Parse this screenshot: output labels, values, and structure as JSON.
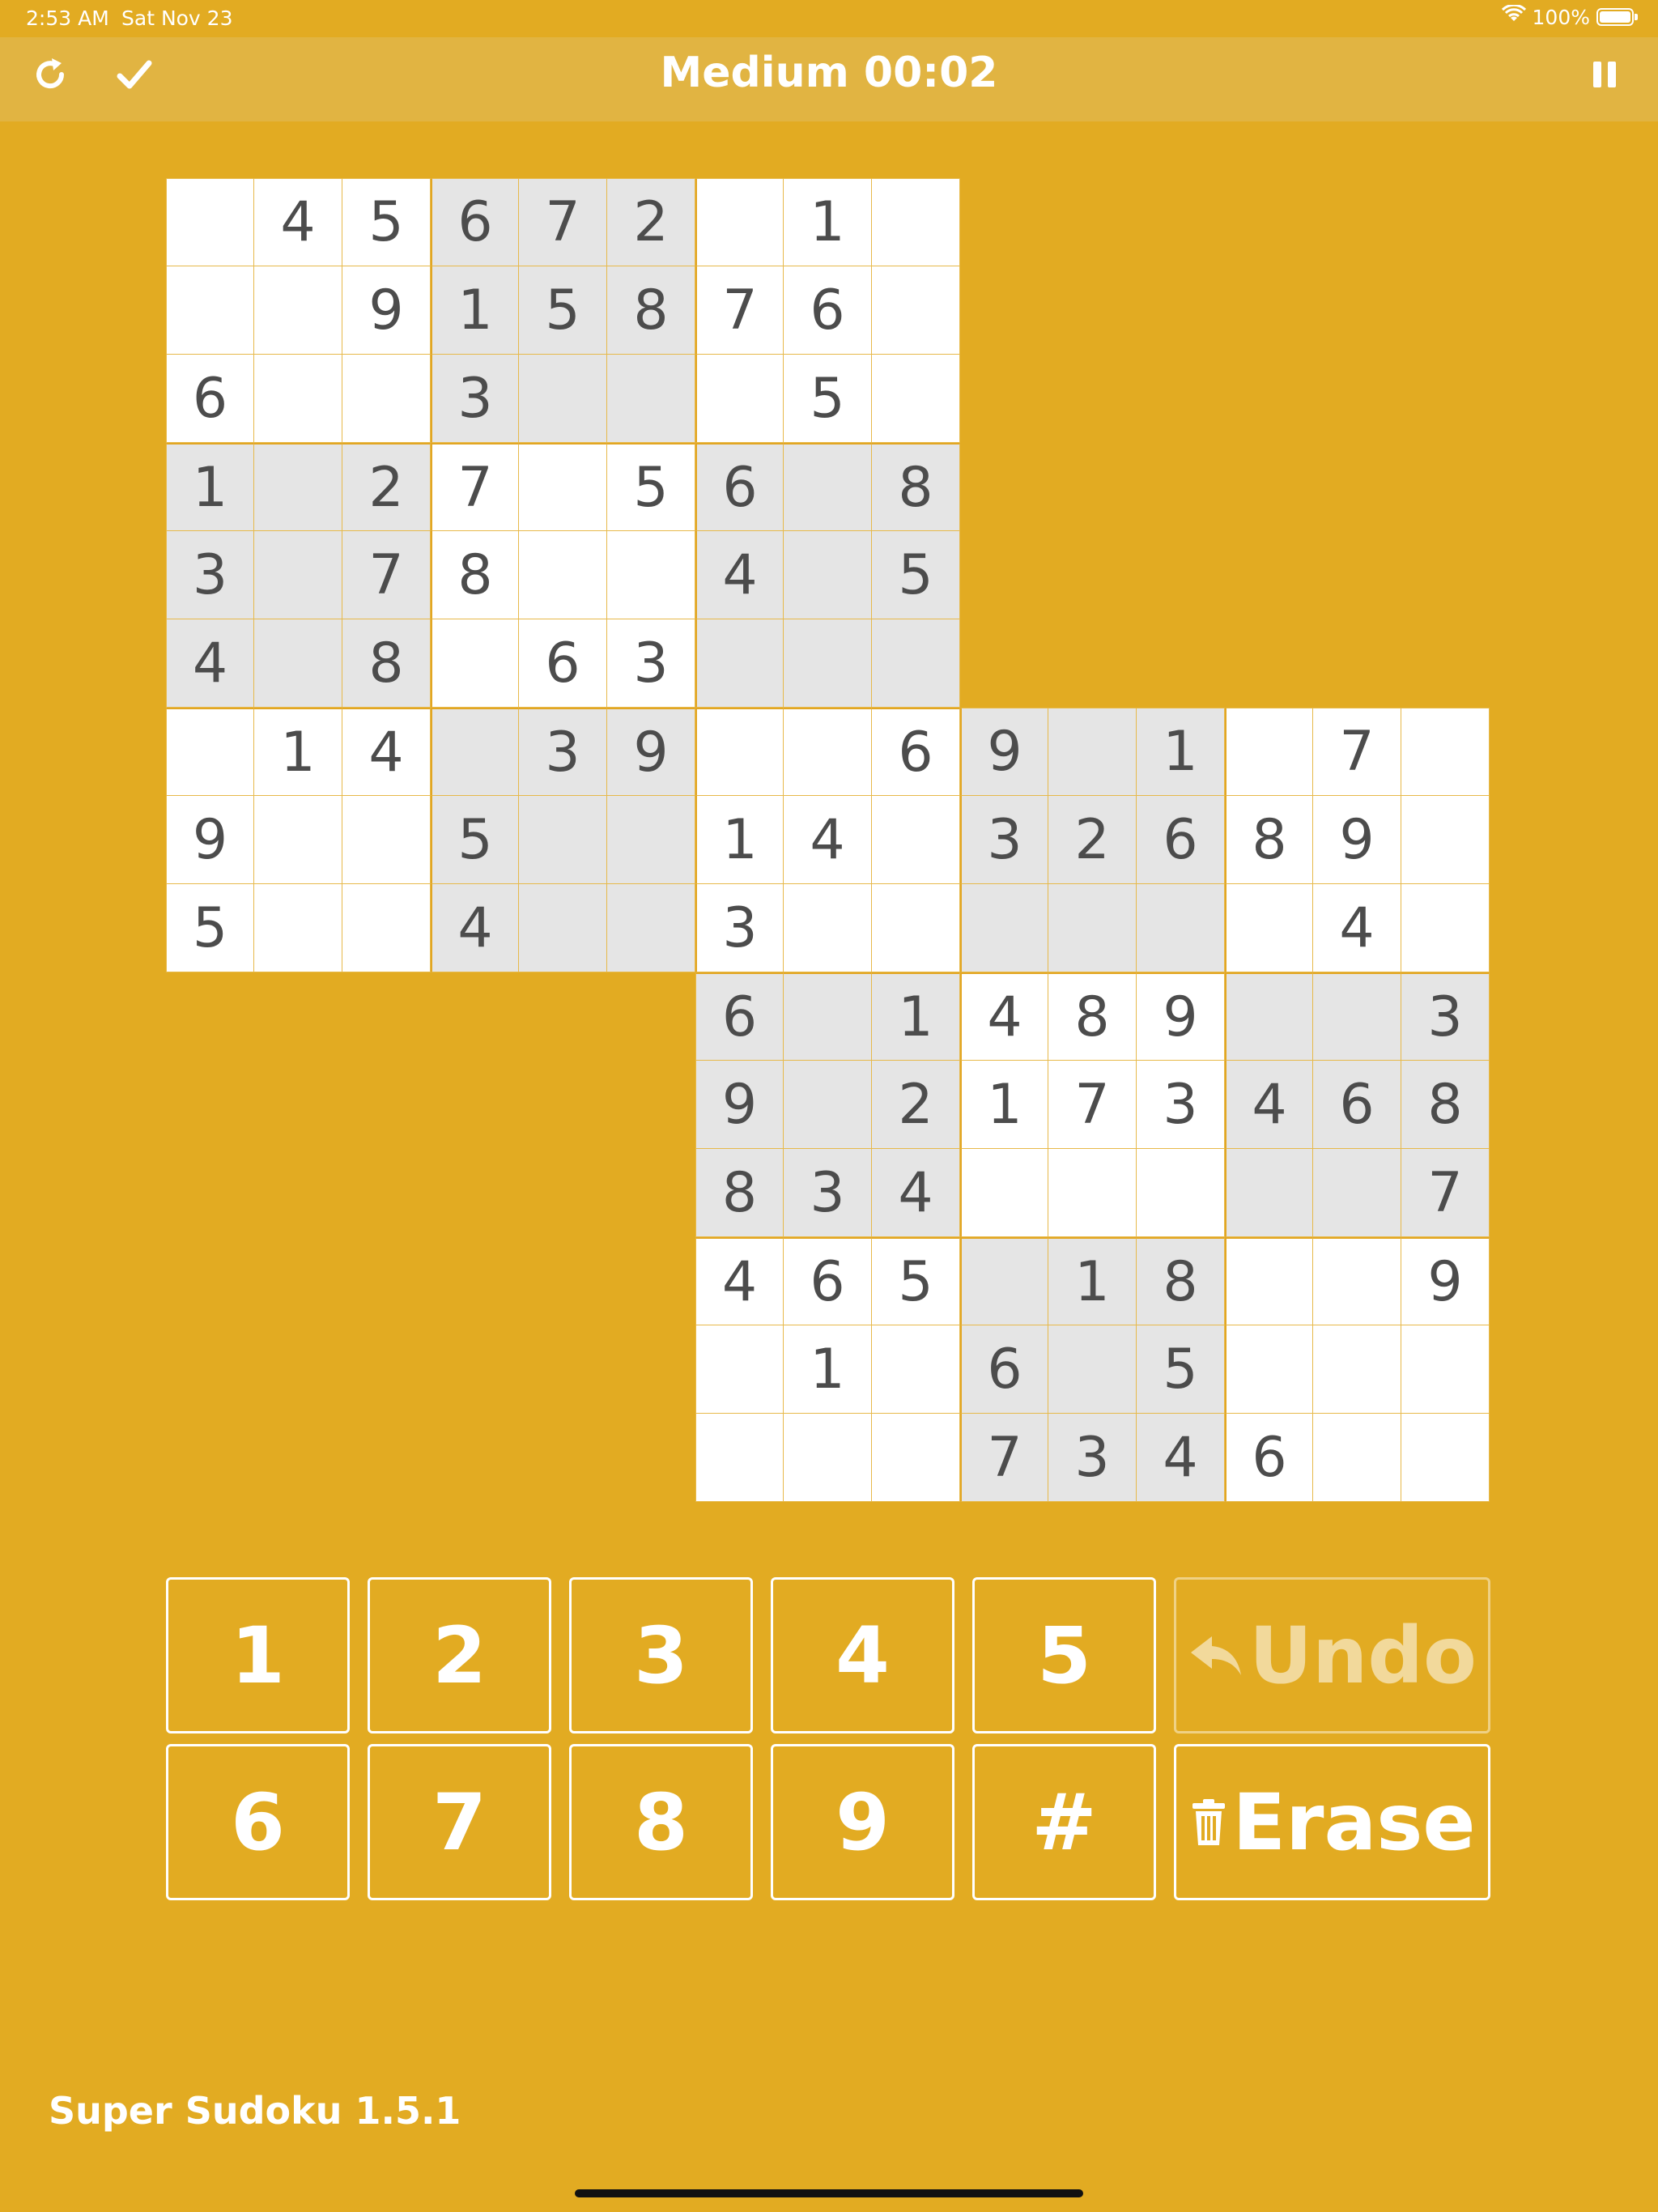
{
  "status_bar": {
    "time": "2:53 AM",
    "date": "Sat Nov 23",
    "battery": "100%",
    "battery_level": 1.0
  },
  "header": {
    "title": "Medium 00:02"
  },
  "icons": {
    "restart": "restart-icon",
    "check": "check-icon",
    "pause": "pause-icon",
    "wifi": "wifi-icon",
    "battery": "battery-icon",
    "undo": "undo-arrow-icon",
    "erase": "trash-icon"
  },
  "colors": {
    "background": "#E2AB22",
    "navbar": "#E1B442",
    "cell_white": "#FFFFFF",
    "cell_grey": "#E5E5E5",
    "digit": "#4C4C4C"
  },
  "grids": [
    {
      "name": "top-left",
      "rows": [
        [
          "",
          "4",
          "5",
          "6",
          "7",
          "2",
          "",
          "1",
          ""
        ],
        [
          "",
          "",
          "9",
          "1",
          "5",
          "8",
          "7",
          "6",
          ""
        ],
        [
          "6",
          "",
          "",
          "3",
          "",
          "",
          "",
          "5",
          ""
        ],
        [
          "1",
          "",
          "2",
          "7",
          "",
          "5",
          "6",
          "",
          "8"
        ],
        [
          "3",
          "",
          "7",
          "8",
          "",
          "",
          "4",
          "",
          "5"
        ],
        [
          "4",
          "",
          "8",
          "",
          "6",
          "3",
          "",
          "",
          ""
        ],
        [
          "",
          "1",
          "4",
          "",
          "3",
          "9",
          "",
          "",
          "6"
        ],
        [
          "9",
          "",
          "",
          "5",
          "",
          "",
          "1",
          "4",
          ""
        ],
        [
          "5",
          "",
          "",
          "4",
          "",
          "",
          "3",
          "",
          ""
        ]
      ]
    },
    {
      "name": "bottom-right",
      "rows": [
        [
          "",
          "",
          "6",
          "9",
          "",
          "1",
          "",
          "7",
          ""
        ],
        [
          "1",
          "4",
          "",
          "3",
          "2",
          "6",
          "8",
          "9",
          ""
        ],
        [
          "3",
          "",
          "",
          "",
          "",
          "",
          "",
          "4",
          ""
        ],
        [
          "6",
          "",
          "1",
          "4",
          "8",
          "9",
          "",
          "",
          "3"
        ],
        [
          "9",
          "",
          "2",
          "1",
          "7",
          "3",
          "4",
          "6",
          "8"
        ],
        [
          "8",
          "3",
          "4",
          "",
          "",
          "",
          "",
          "",
          "7"
        ],
        [
          "4",
          "6",
          "5",
          "",
          "1",
          "8",
          "",
          "",
          "9"
        ],
        [
          "",
          "1",
          "",
          "6",
          "",
          "5",
          "",
          "",
          ""
        ],
        [
          "",
          "",
          "",
          "7",
          "3",
          "4",
          "6",
          "",
          ""
        ]
      ]
    }
  ],
  "keypad": {
    "row1": [
      "1",
      "2",
      "3",
      "4",
      "5"
    ],
    "row2": [
      "6",
      "7",
      "8",
      "9",
      "#"
    ],
    "undo_label": "Undo",
    "undo_enabled": false,
    "erase_label": "Erase"
  },
  "footer": {
    "app_version": "Super Sudoku 1.5.1"
  }
}
